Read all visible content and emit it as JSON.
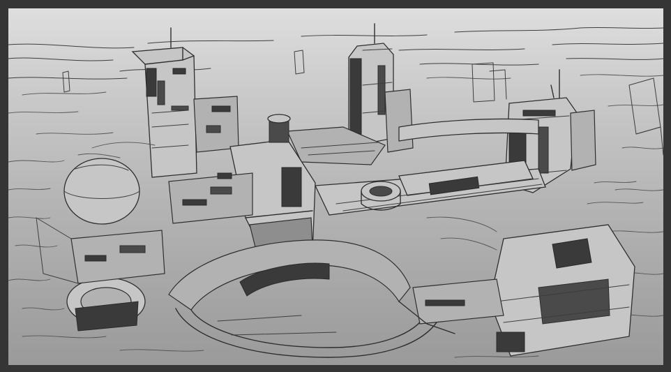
{
  "viewer": {
    "background_color": "#353535",
    "canvas_gradient_top": "#dedede",
    "canvas_gradient_bottom": "#9a9a9a"
  },
  "artwork": {
    "style": "grayscale line sketch",
    "subject_elements": [
      "sphere-dome",
      "left-tower",
      "center-tower",
      "right-tower",
      "central-block",
      "circular-hub",
      "bridge-walkway",
      "ring-platform",
      "lower-right-structure",
      "far-city-skyline"
    ]
  }
}
